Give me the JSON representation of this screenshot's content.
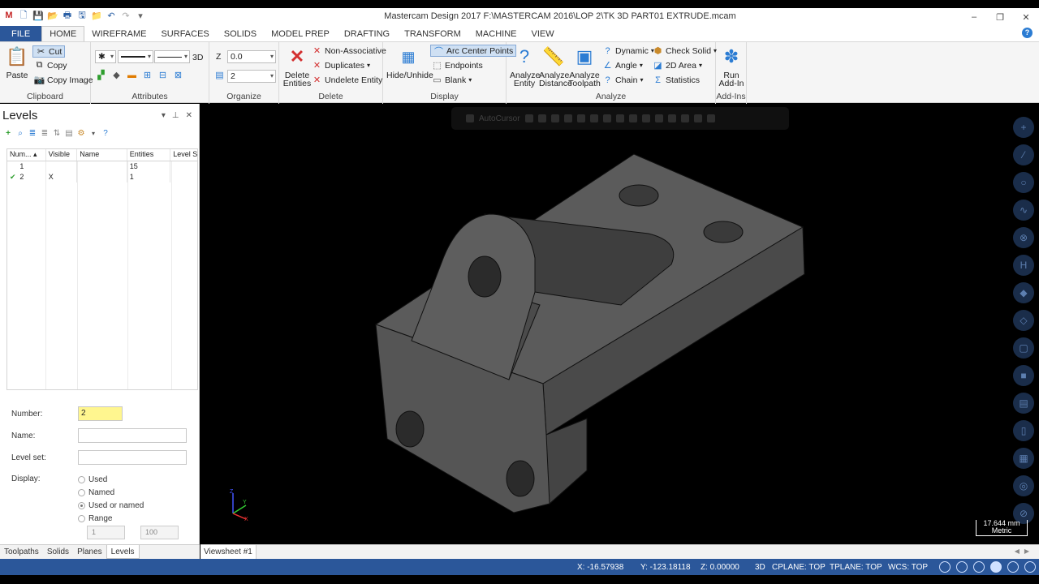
{
  "window": {
    "title": "Mastercam Design 2017  F:\\MASTERCAM 2016\\LOP 2\\TK 3D PART01 EXTRUDE.mcam",
    "minimize": "–",
    "restore": "❐",
    "close": "✕"
  },
  "ribbon_tabs": [
    "FILE",
    "HOME",
    "WIREFRAME",
    "SURFACES",
    "SOLIDS",
    "MODEL PREP",
    "DRAFTING",
    "TRANSFORM",
    "MACHINE",
    "VIEW"
  ],
  "active_tab": "HOME",
  "clipboard": {
    "label": "Clipboard",
    "paste": "Paste",
    "cut": "Cut",
    "copy": "Copy",
    "copy_image": "Copy Image"
  },
  "attributes": {
    "label": "Attributes"
  },
  "organize": {
    "label": "Organize",
    "z_label": "Z",
    "z_value": "0.0",
    "level_value": "2",
    "mode_3d": "3D"
  },
  "delete": {
    "label": "Delete",
    "delete_entities": "Delete Entities",
    "non_associative": "Non-Associative",
    "duplicates": "Duplicates",
    "undelete_entity": "Undelete Entity"
  },
  "display": {
    "label": "Display",
    "hide_unhide": "Hide/Unhide",
    "arc_center_points": "Arc Center Points",
    "endpoints": "Endpoints",
    "blank": "Blank"
  },
  "analyze": {
    "label": "Analyze",
    "analyze_entity": "Analyze Entity",
    "analyze_distance": "Analyze Distance",
    "analyze_toolpath": "Analyze Toolpath",
    "dynamic": "Dynamic",
    "angle": "Angle",
    "chain": "Chain",
    "check_solid": "Check Solid",
    "area_2d": "2D Area",
    "statistics": "Statistics"
  },
  "addins": {
    "label": "Add-Ins",
    "run_addin": "Run Add-In"
  },
  "levels_panel": {
    "title": "Levels",
    "columns": [
      "Num...",
      "Visible",
      "Name",
      "Entities",
      "Level S"
    ],
    "rows": [
      {
        "num": "1",
        "visible": "",
        "name": "",
        "entities": "15",
        "level_set": ""
      },
      {
        "num": "2",
        "visible": "X",
        "name": "",
        "entities": "1",
        "level_set": ""
      }
    ],
    "number_label": "Number:",
    "number_value": "2",
    "name_label": "Name:",
    "name_value": "",
    "level_set_label": "Level set:",
    "level_set_value": "",
    "display_label": "Display:",
    "display_options": [
      "Used",
      "Named",
      "Used or named",
      "Range"
    ],
    "display_selected": "Used or named",
    "range_from": "1",
    "range_to": "100"
  },
  "panel_tabs": [
    "Toolpaths",
    "Solids",
    "Planes",
    "Levels"
  ],
  "active_panel_tab": "Levels",
  "viewport": {
    "autocursor": "AutoCursor",
    "scale_value": "17.644 mm",
    "scale_unit": "Metric"
  },
  "viewsheet": "Viewsheet #1",
  "status": {
    "x": "X:  -16.57938",
    "y": "Y:  -123.18118",
    "z": "Z:  0.00000",
    "mode": "3D",
    "cplane": "CPLANE: TOP",
    "tplane": "TPLANE: TOP",
    "wcs": "WCS: TOP"
  },
  "colors": {
    "accent": "#2b579a",
    "part": "#595959",
    "viewport": "#000000"
  }
}
